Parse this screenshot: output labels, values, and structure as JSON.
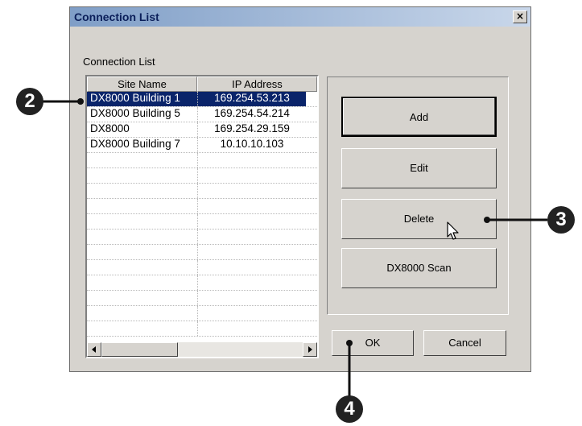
{
  "dialog": {
    "title": "Connection List",
    "close_glyph": "×",
    "group_label": "Connection List"
  },
  "listview": {
    "columns": [
      "Site Name",
      "IP Address"
    ],
    "rows": [
      {
        "site": "DX8000 Building 1",
        "ip": "169.254.53.213",
        "selected": true
      },
      {
        "site": "DX8000 Building 5",
        "ip": "169.254.54.214"
      },
      {
        "site": "DX8000",
        "ip": "169.254.29.159"
      },
      {
        "site": "DX8000 Building 7",
        "ip": "10.10.10.103"
      }
    ],
    "empty_row_count": 12
  },
  "buttons": {
    "add": "Add",
    "edit": "Edit",
    "delete": "Delete",
    "scan": "DX8000 Scan",
    "ok": "OK",
    "cancel": "Cancel"
  },
  "callouts": [
    "2",
    "3",
    "4"
  ],
  "icons": {
    "close": "close-icon",
    "scroll_left": "arrow-left-icon",
    "scroll_right": "arrow-right-icon",
    "cursor": "mouse-pointer-icon"
  },
  "colors": {
    "selection": "#0a246a",
    "dialog_bg": "#d6d3ce",
    "title_gradient_start": "#7f9ec7"
  }
}
